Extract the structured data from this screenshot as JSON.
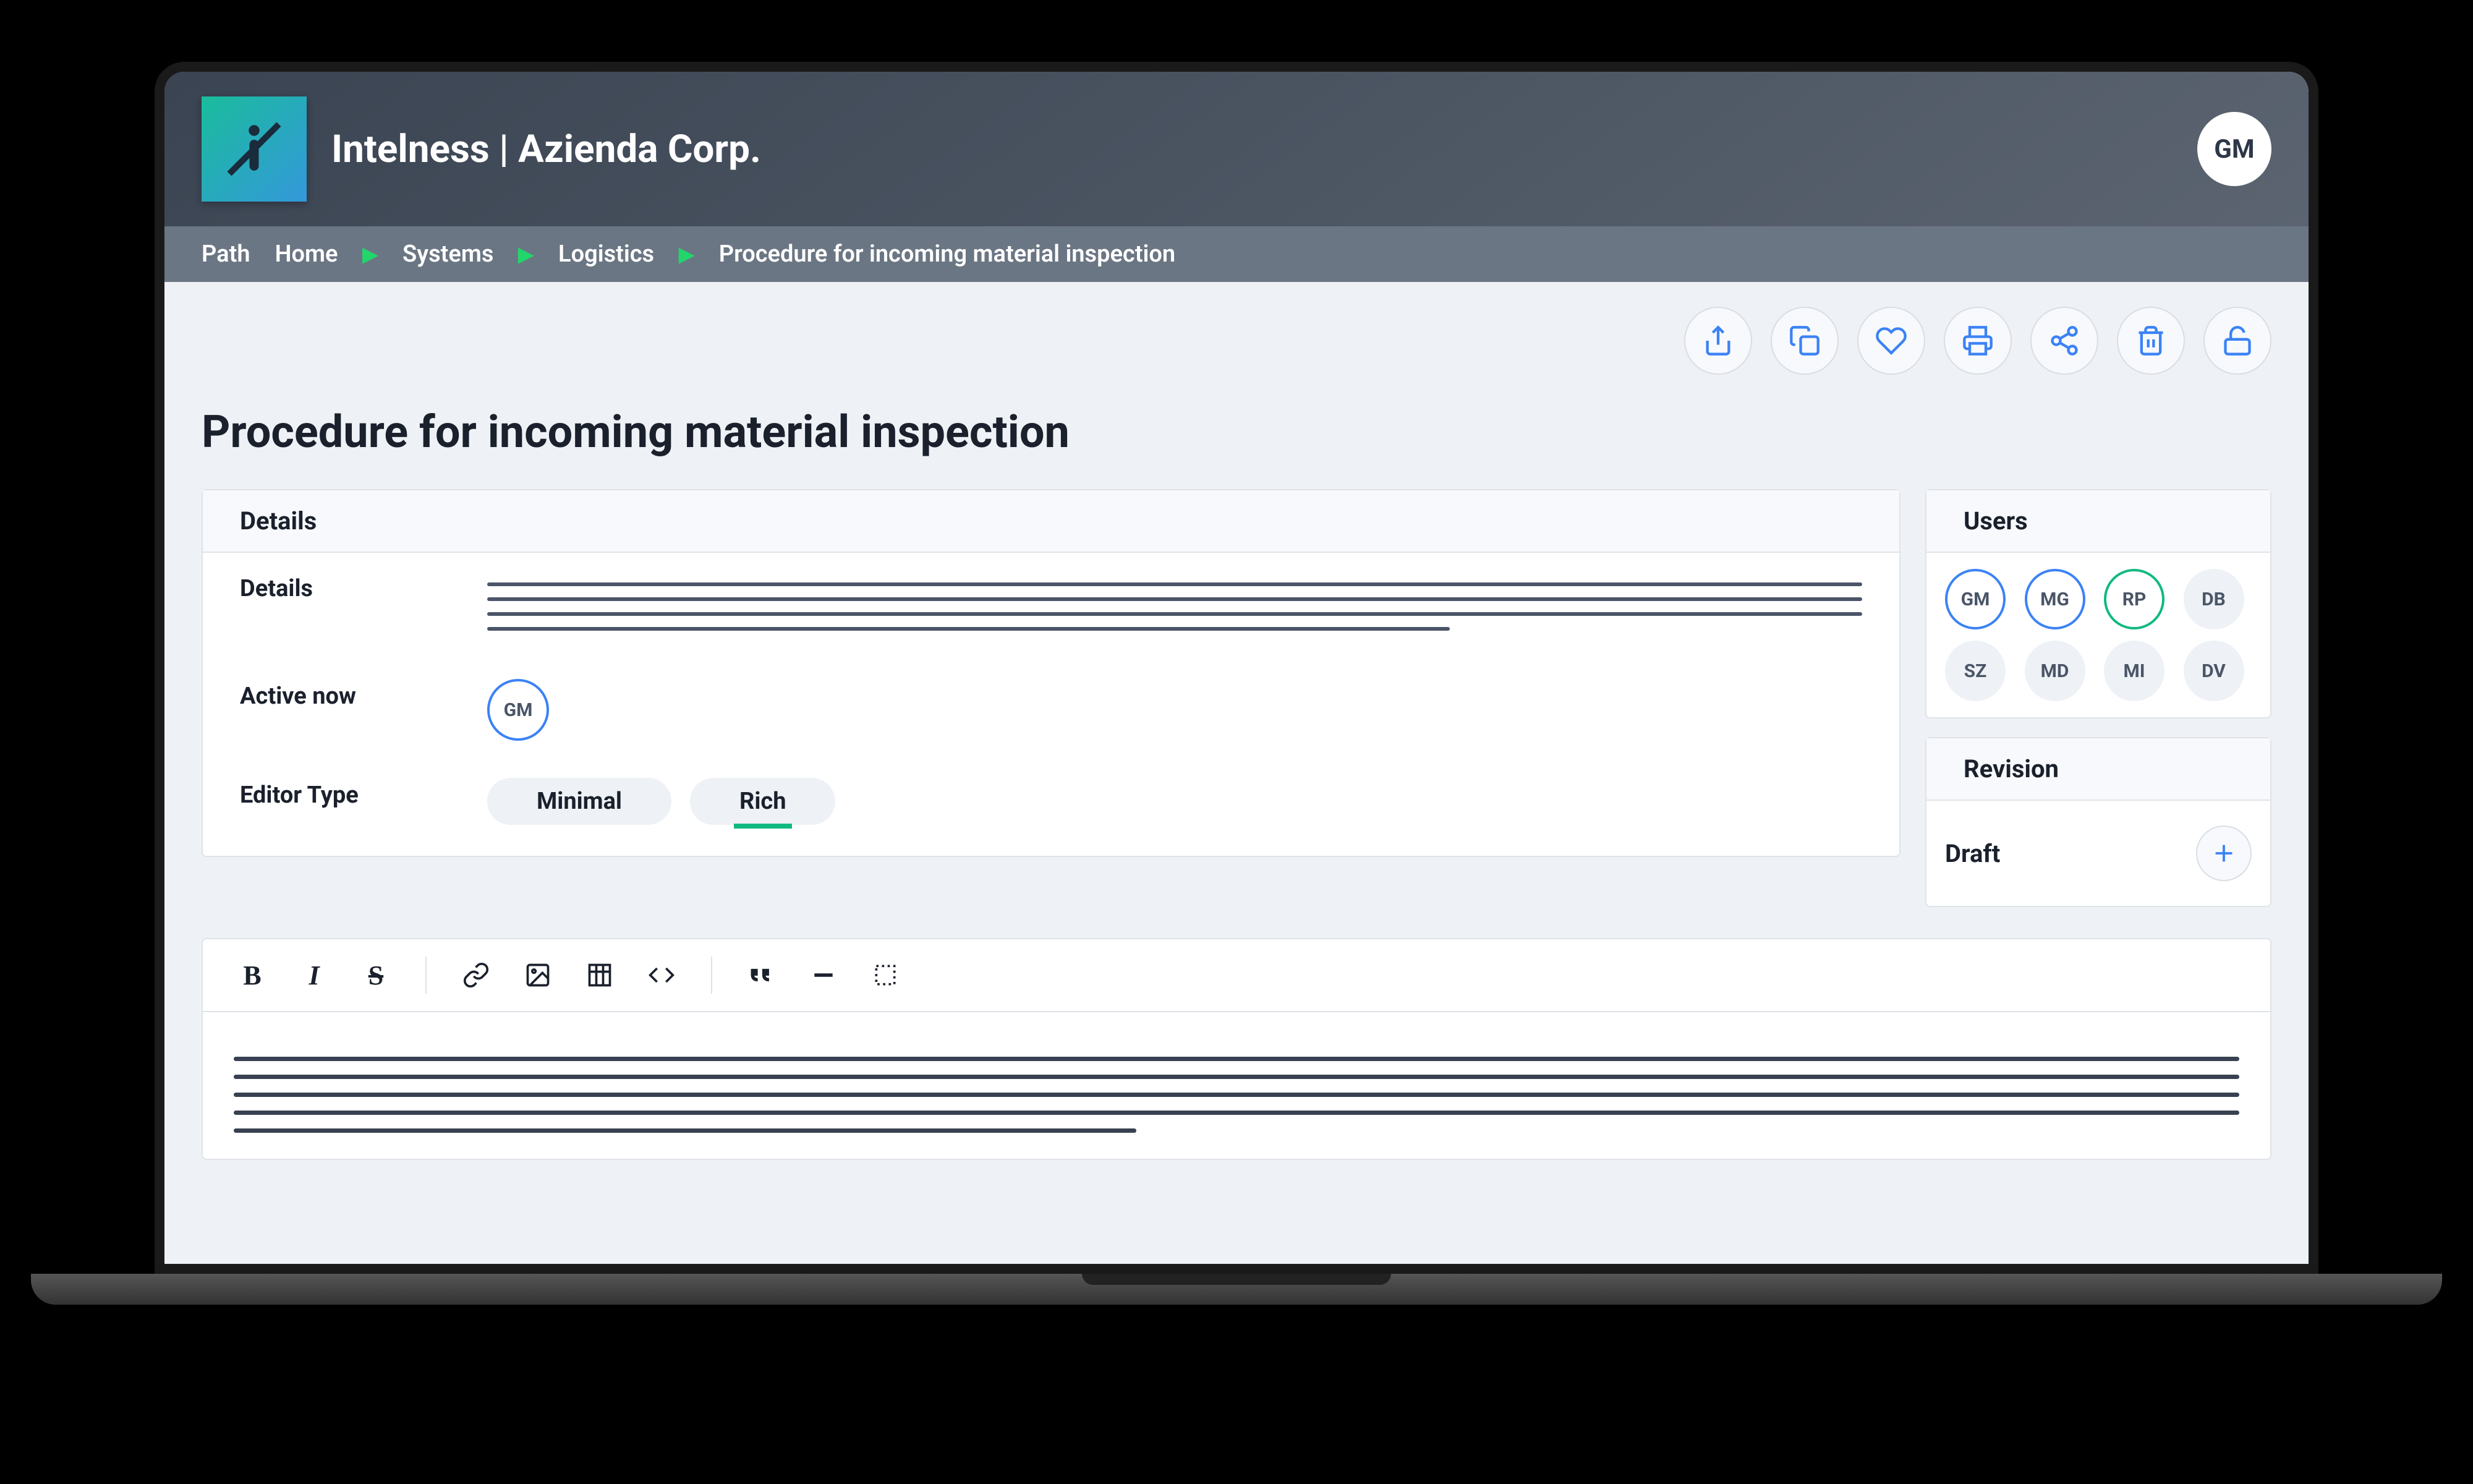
{
  "header": {
    "title": "Intelness | Azienda Corp.",
    "avatar": "GM"
  },
  "breadcrumb": {
    "label": "Path",
    "items": [
      "Home",
      "Systems",
      "Logistics",
      "Procedure for incoming material inspection"
    ]
  },
  "actions": {
    "export": "export-icon",
    "copy": "copy-icon",
    "favorite": "heart-icon",
    "print": "print-icon",
    "share": "share-icon",
    "delete": "trash-icon",
    "unlock": "unlock-icon"
  },
  "page": {
    "title": "Procedure for incoming material inspection"
  },
  "details_panel": {
    "heading": "Details",
    "rows": {
      "details_label": "Details",
      "active_label": "Active now",
      "active_user": "GM",
      "editor_type_label": "Editor Type",
      "editor_type_options": {
        "minimal": "Minimal",
        "rich": "Rich"
      },
      "editor_type_selected": "rich"
    }
  },
  "users_panel": {
    "heading": "Users",
    "items": [
      {
        "initials": "GM",
        "state": "blue"
      },
      {
        "initials": "MG",
        "state": "blue"
      },
      {
        "initials": "RP",
        "state": "green"
      },
      {
        "initials": "DB",
        "state": ""
      },
      {
        "initials": "SZ",
        "state": ""
      },
      {
        "initials": "MD",
        "state": ""
      },
      {
        "initials": "MI",
        "state": ""
      },
      {
        "initials": "DV",
        "state": ""
      }
    ]
  },
  "revision_panel": {
    "heading": "Revision",
    "status": "Draft"
  }
}
